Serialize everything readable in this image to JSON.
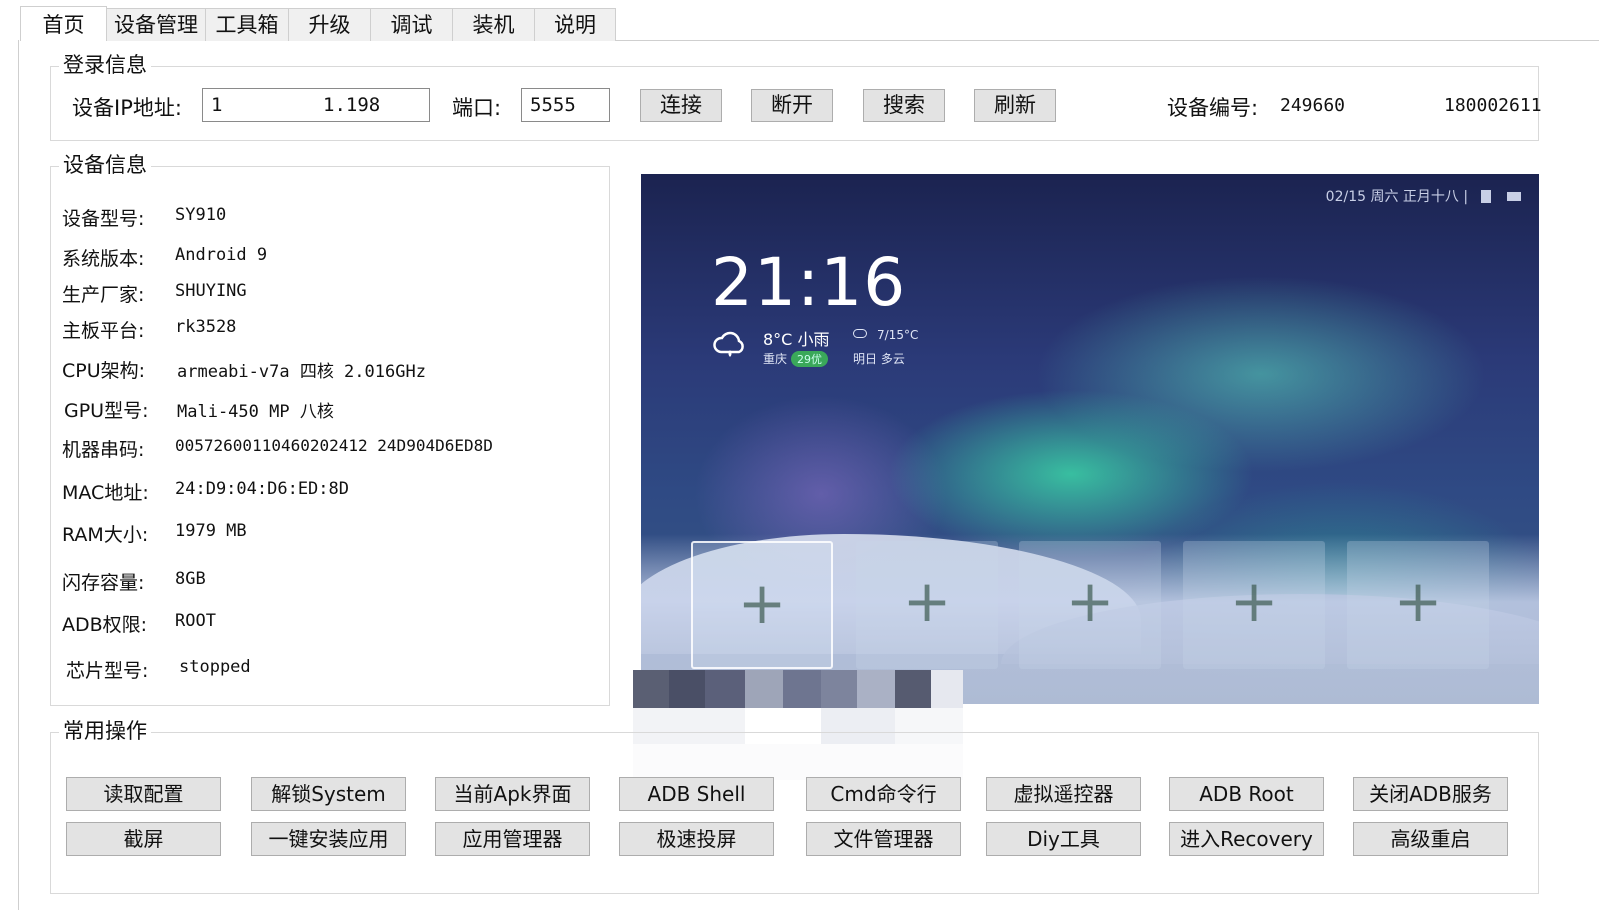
{
  "tabs": [
    "首页",
    "设备管理",
    "工具箱",
    "升级",
    "调试",
    "装机",
    "说明"
  ],
  "login": {
    "legend": "登录信息",
    "ip_label": "设备IP地址:",
    "ip_value_start": "1",
    "ip_value_end": "1.198",
    "port_label": "端口:",
    "port_value": "5555",
    "connect": "连接",
    "disconnect": "断开",
    "search": "搜索",
    "refresh": "刷新",
    "serial_label": "设备编号:",
    "serial_start": "249660",
    "serial_end": "180002611"
  },
  "device": {
    "legend": "设备信息",
    "rows": [
      {
        "k": "设备型号:",
        "v": "SY910"
      },
      {
        "k": "系统版本:",
        "v": "Android 9"
      },
      {
        "k": "生产厂家:",
        "v": "SHUYING"
      },
      {
        "k": "主板平台:",
        "v": "rk3528"
      },
      {
        "k": "CPU架构:",
        "v": "armeabi-v7a 四核 2.016GHz"
      },
      {
        "k": "GPU型号:",
        "v": "Mali-450 MP 八核"
      },
      {
        "k": "机器串码:",
        "v": "00572600110460202412 24D904D6ED8D"
      },
      {
        "k": "MAC地址:",
        "v": "24:D9:04:D6:ED:8D"
      },
      {
        "k": "RAM大小:",
        "v": "1979 MB"
      },
      {
        "k": "闪存容量:",
        "v": "8GB"
      },
      {
        "k": "ADB权限:",
        "v": "ROOT"
      },
      {
        "k": "芯片型号:",
        "v": "stopped"
      }
    ]
  },
  "preview": {
    "status": "02/15  周六  正月十八  |",
    "clock": "21:16",
    "temp": "8°C 小雨",
    "city": "重庆",
    "aqi": "29优",
    "forecast_temp": "7/15°C",
    "forecast_day": "明日   多云",
    "slot_symbol": "+"
  },
  "ops": {
    "legend": "常用操作",
    "row1": [
      "读取配置",
      "解锁System",
      "当前Apk界面",
      "ADB Shell",
      "Cmd命令行",
      "虚拟遥控器",
      "ADB  Root",
      "关闭ADB服务"
    ],
    "row2": [
      "截屏",
      "一键安装应用",
      "应用管理器",
      "极速投屏",
      "文件管理器",
      "Diy工具",
      "进入Recovery",
      "高级重启"
    ]
  }
}
